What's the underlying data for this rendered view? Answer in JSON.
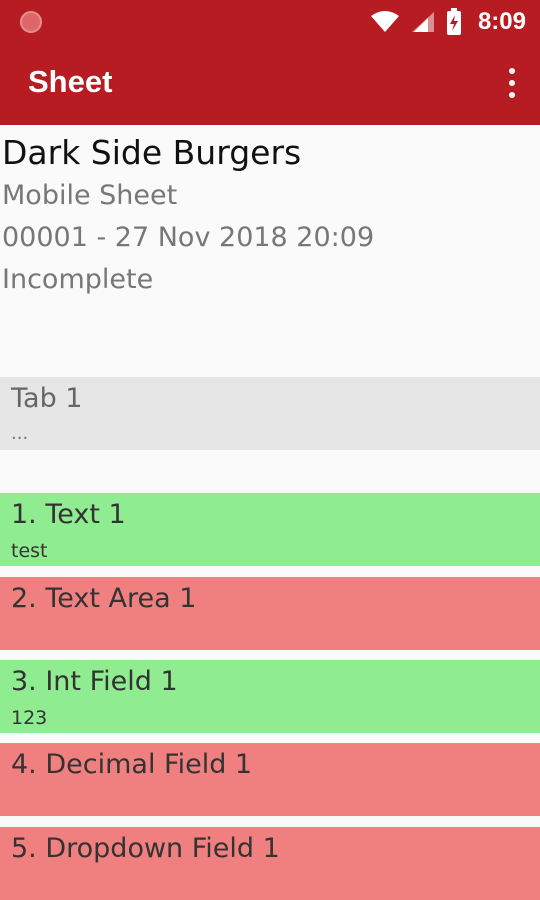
{
  "status_bar": {
    "time": "8:09"
  },
  "app_bar": {
    "title": "Sheet"
  },
  "sheet": {
    "company": "Dark Side Burgers",
    "type": "Mobile Sheet",
    "code_date": "00001 - 27 Nov 2018 20:09",
    "status": "Incomplete"
  },
  "tab": {
    "title": "Tab 1",
    "subtitle": "..."
  },
  "fields": [
    {
      "label": "1. Text 1",
      "value": "test",
      "state": "complete",
      "color": "#90ec90"
    },
    {
      "label": "2. Text Area 1",
      "value": "",
      "state": "incomplete",
      "color": "#f08080"
    },
    {
      "label": "3. Int Field 1",
      "value": "123",
      "state": "complete",
      "color": "#90ec90"
    },
    {
      "label": "4. Decimal Field 1",
      "value": "",
      "state": "incomplete",
      "color": "#f08080"
    },
    {
      "label": "5. Dropdown Field 1",
      "value": "",
      "state": "incomplete",
      "color": "#f08080"
    }
  ],
  "colors": {
    "primary": "#b71c22",
    "complete": "#90ec90",
    "incomplete": "#f08080"
  }
}
